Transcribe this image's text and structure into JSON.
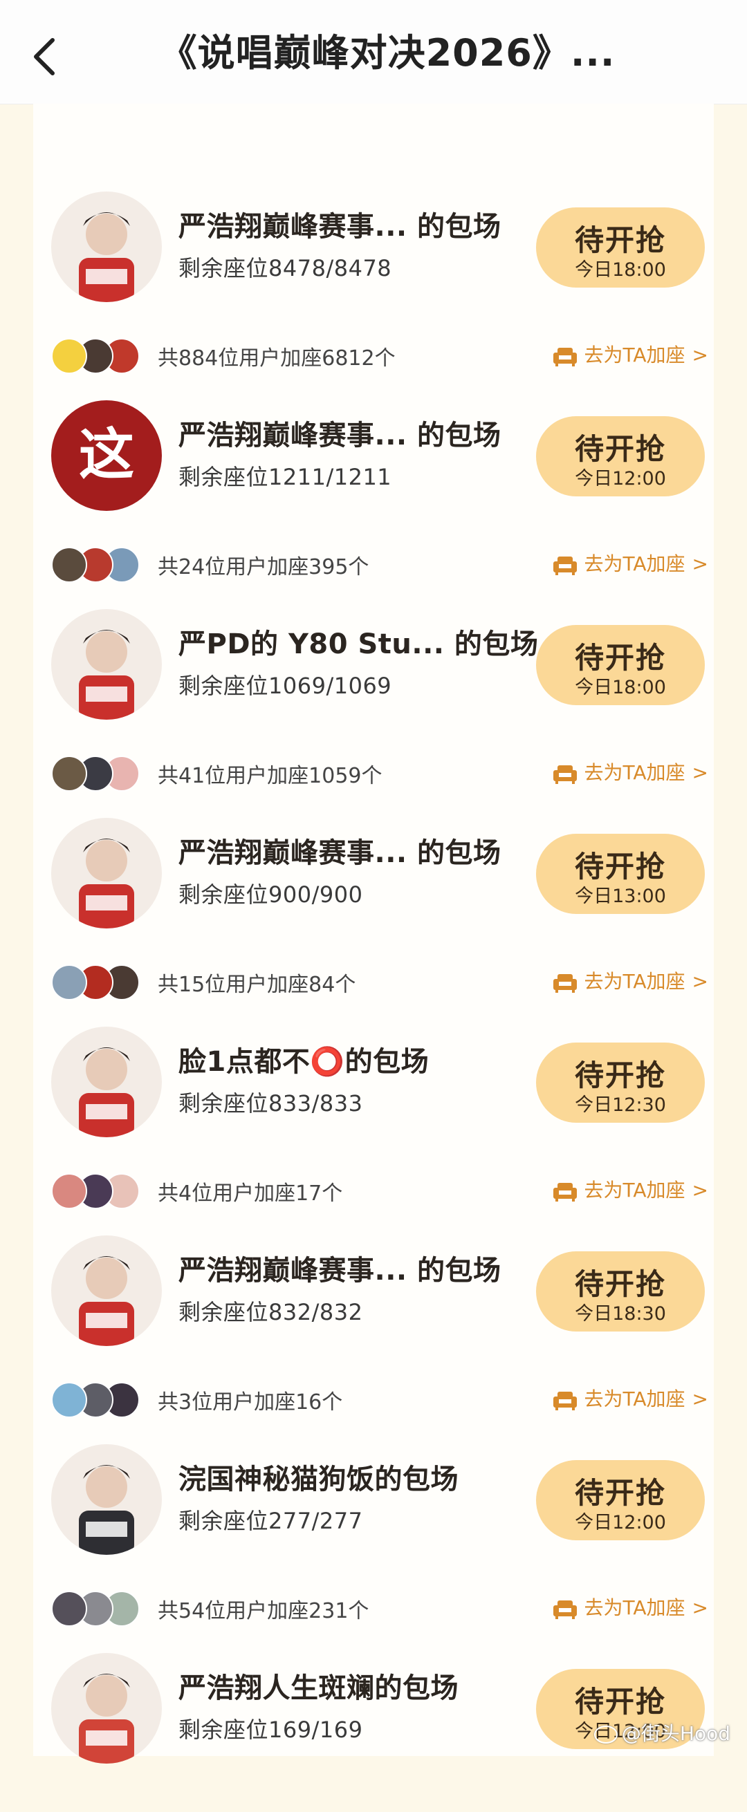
{
  "header": {
    "title": "《说唱巅峰对决2026》..."
  },
  "colors": {
    "accent": "#d88a2a",
    "button": "#fbd897",
    "panel": "#fffefb",
    "page": "#fdf8e9"
  },
  "events": [
    {
      "title": "严浩翔巅峰赛事... 的包场",
      "seats": "剩余座位8478/8478",
      "button": "待开抢",
      "time": "今日18:00",
      "joined": "共884位用户加座6812个",
      "join_label": "去为TA加座",
      "avatar_color": "#c9302c",
      "mini_colors": [
        "#f4d03f",
        "#4a3a33",
        "#c0392b"
      ]
    },
    {
      "title": "严浩翔巅峰赛事... 的包场",
      "seats": "剩余座位1211/1211",
      "button": "待开抢",
      "time": "今日12:00",
      "joined": "共24位用户加座395个",
      "join_label": "去为TA加座",
      "avatar_color": "#a31d1d",
      "avatar_text": "这",
      "mini_colors": [
        "#5a4b3d",
        "#b83a2e",
        "#7a9ab8"
      ]
    },
    {
      "title": "严PD的 Y80 Stu... 的包场",
      "seats": "剩余座位1069/1069",
      "button": "待开抢",
      "time": "今日18:00",
      "joined": "共41位用户加座1059个",
      "join_label": "去为TA加座",
      "avatar_color": "#c9302c",
      "mini_colors": [
        "#6b5a45",
        "#3b3b44",
        "#e8b4b0"
      ]
    },
    {
      "title": "严浩翔巅峰赛事... 的包场",
      "seats": "剩余座位900/900",
      "button": "待开抢",
      "time": "今日13:00",
      "joined": "共15位用户加座84个",
      "join_label": "去为TA加座",
      "avatar_color": "#c9302c",
      "mini_colors": [
        "#8aa0b5",
        "#b32c20",
        "#4a3a33"
      ]
    },
    {
      "title": "脸1点都不⭕的包场",
      "seats": "剩余座位833/833",
      "button": "待开抢",
      "time": "今日12:30",
      "joined": "共4位用户加座17个",
      "join_label": "去为TA加座",
      "avatar_color": "#c9302c",
      "mini_colors": [
        "#d98880",
        "#4a3a55",
        "#e8c2b8"
      ]
    },
    {
      "title": "严浩翔巅峰赛事... 的包场",
      "seats": "剩余座位832/832",
      "button": "待开抢",
      "time": "今日18:30",
      "joined": "共3位用户加座16个",
      "join_label": "去为TA加座",
      "avatar_color": "#c9302c",
      "mini_colors": [
        "#7fb3d5",
        "#5d5d66",
        "#3b3340"
      ]
    },
    {
      "title": "浣国神秘猫狗饭的包场",
      "seats": "剩余座位277/277",
      "button": "待开抢",
      "time": "今日12:00",
      "joined": "共54位用户加座231个",
      "join_label": "去为TA加座",
      "avatar_color": "#2e2e33",
      "mini_colors": [
        "#55505a",
        "#8a8a90",
        "#a4b5a8"
      ]
    },
    {
      "title": "严浩翔人生斑斓的包场",
      "seats": "剩余座位169/169",
      "button": "待开抢",
      "time": "今日12:00",
      "joined": "",
      "join_label": "",
      "avatar_color": "#d14438",
      "mini_colors": []
    }
  ],
  "watermark": "@街头Hood"
}
